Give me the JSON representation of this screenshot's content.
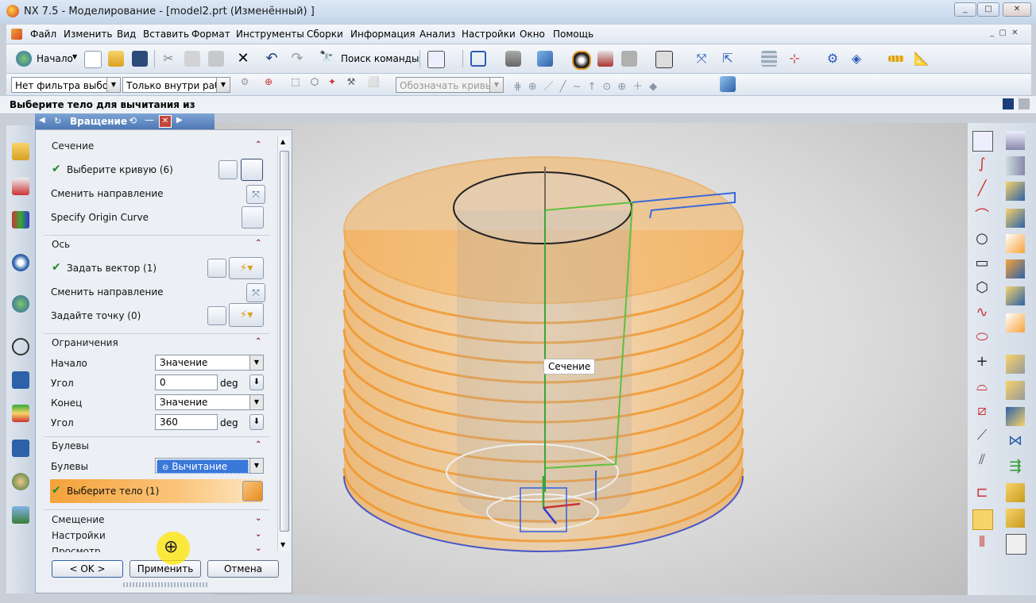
{
  "window": {
    "title": "NX 7.5 - Моделирование - [model2.prt (Изменённый) ]",
    "min": "▭",
    "max": "▢",
    "close": "✕"
  },
  "menu": [
    "Файл",
    "Изменить",
    "Вид",
    "Вставить",
    "Формат",
    "Инструменты",
    "Сборки",
    "Информация",
    "Анализ",
    "Настройки",
    "Окно",
    "Помощь"
  ],
  "toolbar": {
    "start_label": "Начало",
    "search_label": "Поиск команды"
  },
  "selection_bar": {
    "filter": "Нет фильтра выбор",
    "scope": "Только внутри рабо",
    "curves": "Обозначать кривые"
  },
  "cue_line": "Выберите тело для вычитания из",
  "dialog": {
    "title": "Вращение",
    "section": {
      "title": "Сечение",
      "select_curve": "Выберите кривую (6)",
      "reverse": "Сменить направление",
      "origin": "Specify Origin Curve"
    },
    "axis": {
      "title": "Ось",
      "vector": "Задать вектор (1)",
      "reverse": "Сменить направление",
      "point": "Задайте точку (0)"
    },
    "limits": {
      "title": "Ограничения",
      "start_label": "Начало",
      "start_value": "Значение",
      "angle1_label": "Угол",
      "angle1_value": "0",
      "angle1_unit": "deg",
      "end_label": "Конец",
      "end_value": "Значение",
      "angle2_label": "Угол",
      "angle2_value": "360",
      "angle2_unit": "deg"
    },
    "boolean": {
      "title": "Булевы",
      "label": "Булевы",
      "value": "Вычитание",
      "select_body": "Выберите тело (1)"
    },
    "offset_title": "Смещение",
    "settings_title": "Настройки",
    "preview_title": "Просмотр",
    "ok": "< OK >",
    "apply": "Применить",
    "cancel": "Отмена"
  },
  "viewport": {
    "tooltip": "Сечение"
  },
  "colors": {
    "accent_orange": "#f6a23c",
    "title_blue": "#4d78b5",
    "check_green": "#1d8a2a"
  }
}
